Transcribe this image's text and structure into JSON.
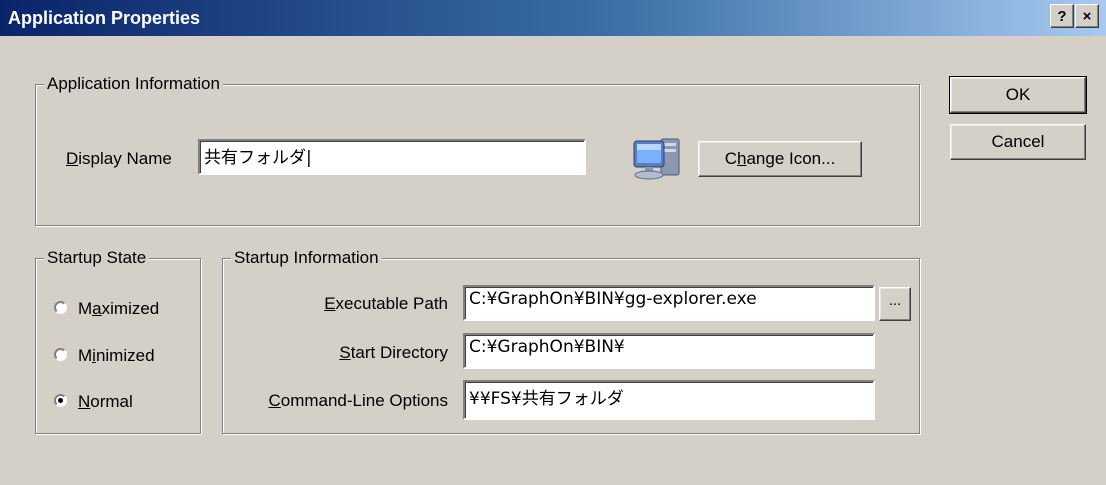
{
  "window": {
    "title": "Application Properties",
    "help_button": "?",
    "close_button": "×"
  },
  "buttons": {
    "ok": "OK",
    "cancel": "Cancel"
  },
  "app_info": {
    "group_label": "Application Information",
    "display_name_label_hotkey": "D",
    "display_name_label_rest": "isplay Name",
    "display_name_value": "共有フォルダ|",
    "change_icon_pre": "C",
    "change_icon_hotkey": "h",
    "change_icon_post": "ange Icon..."
  },
  "startup_state": {
    "group_label": "Startup State",
    "options": [
      {
        "pre": "M",
        "hotkey": "a",
        "post": "ximized",
        "selected": false
      },
      {
        "pre": "M",
        "hotkey": "i",
        "post": "nimized",
        "selected": false
      },
      {
        "pre": "",
        "hotkey": "N",
        "post": "ormal",
        "selected": true
      }
    ]
  },
  "startup_info": {
    "group_label": "Startup Information",
    "executable_path_hotkey": "E",
    "executable_path_rest": "xecutable Path",
    "executable_path_value": "C:¥GraphOn¥BIN¥gg-explorer.exe",
    "browse_button": "...",
    "start_directory_hotkey": "S",
    "start_directory_rest": "tart Directory",
    "start_directory_value": "C:¥GraphOn¥BIN¥",
    "cmdline_hotkey": "C",
    "cmdline_rest": "ommand-Line Options",
    "cmdline_value": "¥¥FS¥共有フォルダ"
  }
}
